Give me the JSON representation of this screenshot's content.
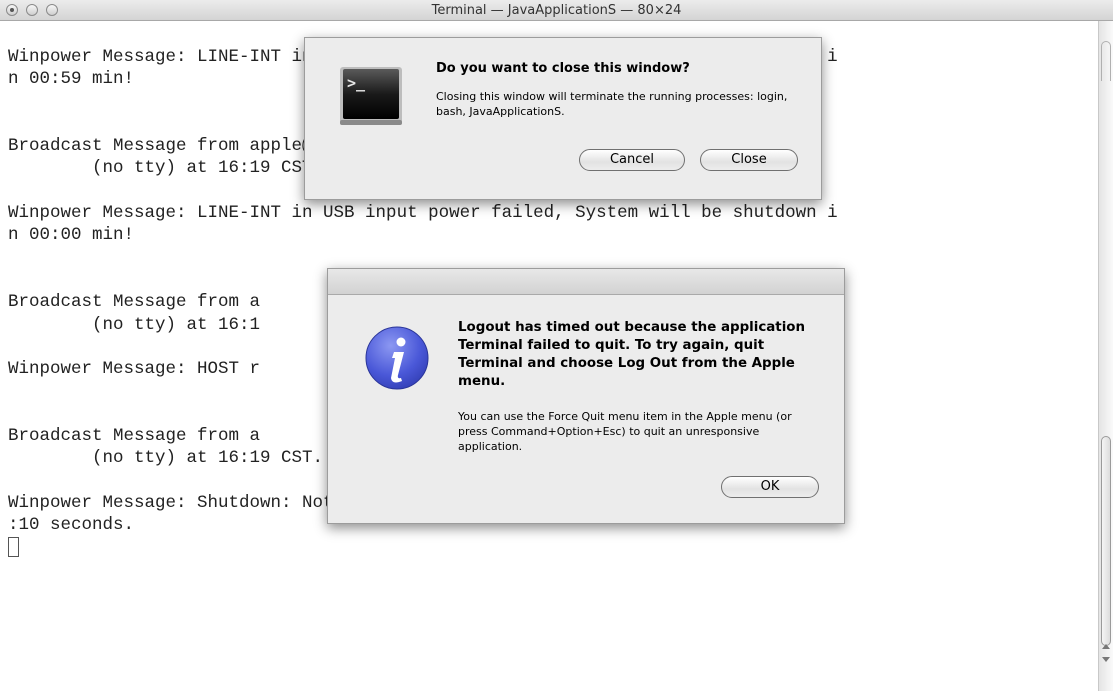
{
  "window": {
    "title": "Terminal — JavaApplicationS — 80×24"
  },
  "terminal": {
    "lines": [
      "Winpower Message: LINE-INT in USB input power failed, System will be shutdown i",
      "n 00:59 min!",
      "",
      "",
      "Broadcast Message from apple@mac002",
      "        (no tty) at 16:19 CST...",
      "",
      "Winpower Message: LINE-INT in USB input power failed, System will be shutdown i",
      "n 00:00 min!",
      "",
      "",
      "Broadcast Message from a",
      "        (no tty) at 16:1",
      "",
      "Winpower Message: HOST r",
      "",
      "",
      "Broadcast Message from a",
      "        (no tty) at 16:19 CST...",
      "",
      "Winpower Message: Shutdown: Notifying workstations to shut down, waiting for 00",
      ":10 seconds.",
      ""
    ]
  },
  "close_dialog": {
    "heading": "Do you want to close this window?",
    "body": "Closing this window will terminate the running processes: login, bash, JavaApplicationS.",
    "cancel_label": "Cancel",
    "close_label": "Close",
    "icon": "terminal-icon"
  },
  "logout_dialog": {
    "heading": "Logout has timed out because the application Terminal failed to quit. To try again, quit Terminal and choose Log Out from the Apple menu.",
    "body": "You can use the Force Quit menu item in the Apple menu (or press Command+Option+Esc) to quit an unresponsive application.",
    "ok_label": "OK",
    "icon": "info-icon",
    "icon_color": "#4a58d8"
  }
}
